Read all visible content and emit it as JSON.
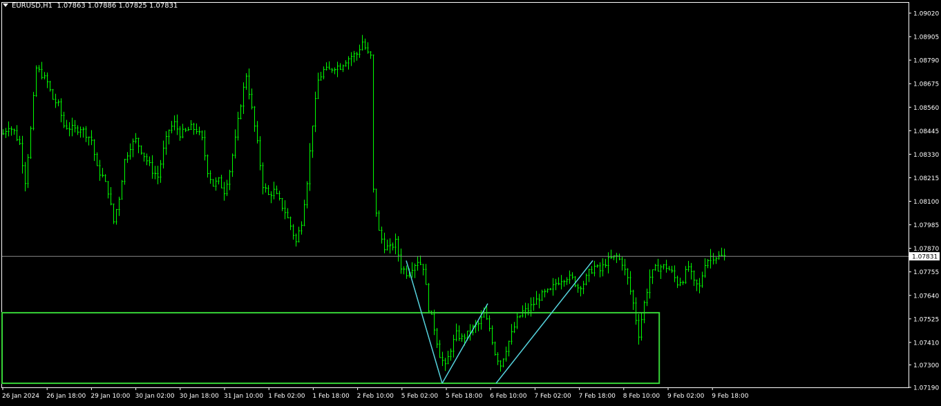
{
  "header": {
    "symbol": "EURUSD,H1",
    "ohlc": "1.07863 1.07886 1.07825 1.07831"
  },
  "colors": {
    "background": "#000000",
    "candle": "#00ff00",
    "frame": "#ffffff",
    "zone": "#37d537",
    "trendline": "#55d3dd",
    "price_line": "#8a8a8a"
  },
  "chart_data": {
    "type": "candlestick",
    "symbol": "EURUSD",
    "timeframe": "H1",
    "current_price": 1.07831,
    "current_price_label": "1.07831",
    "ylim": [
      1.0714,
      1.091
    ],
    "y_ticks": [
      "1.09020",
      "1.08905",
      "1.08790",
      "1.08675",
      "1.08560",
      "1.08445",
      "1.08330",
      "1.08215",
      "1.08100",
      "1.07985",
      "1.07870",
      "1.07755",
      "1.07640",
      "1.07525",
      "1.07410",
      "1.07300",
      "1.07190"
    ],
    "x_ticks": [
      "26 Jan 2024",
      "26 Jan 18:00",
      "29 Jan 10:00",
      "30 Jan 02:00",
      "30 Jan 18:00",
      "31 Jan 10:00",
      "1 Feb 02:00",
      "1 Feb 18:00",
      "2 Feb 10:00",
      "5 Feb 02:00",
      "5 Feb 18:00",
      "6 Feb 10:00",
      "7 Feb 02:00",
      "7 Feb 18:00",
      "8 Feb 10:00",
      "9 Feb 02:00",
      "9 Feb 18:00"
    ],
    "close_path": [
      [
        0,
        1.0843
      ],
      [
        8,
        1.0847
      ],
      [
        16,
        1.0844
      ],
      [
        24,
        1.0838
      ],
      [
        32,
        1.082
      ],
      [
        40,
        1.0845
      ],
      [
        48,
        1.0875
      ],
      [
        56,
        1.0872
      ],
      [
        64,
        1.0868
      ],
      [
        72,
        1.086
      ],
      [
        80,
        1.0857
      ],
      [
        88,
        1.0847
      ],
      [
        96,
        1.0846
      ],
      [
        104,
        1.0845
      ],
      [
        112,
        1.0846
      ],
      [
        120,
        1.0843
      ],
      [
        128,
        1.084
      ],
      [
        136,
        1.0826
      ],
      [
        144,
        1.0822
      ],
      [
        152,
        1.0815
      ],
      [
        160,
        1.08
      ],
      [
        168,
        1.0812
      ],
      [
        176,
        1.083
      ],
      [
        184,
        1.0837
      ],
      [
        192,
        1.084
      ],
      [
        200,
        1.0835
      ],
      [
        208,
        1.083
      ],
      [
        216,
        1.0825
      ],
      [
        224,
        1.0822
      ],
      [
        232,
        1.0835
      ],
      [
        240,
        1.0845
      ],
      [
        248,
        1.0848
      ],
      [
        256,
        1.0843
      ],
      [
        264,
        1.0844
      ],
      [
        272,
        1.0846
      ],
      [
        280,
        1.0845
      ],
      [
        288,
        1.084
      ],
      [
        296,
        1.0825
      ],
      [
        304,
        1.0818
      ],
      [
        312,
        1.082
      ],
      [
        320,
        1.0815
      ],
      [
        328,
        1.0825
      ],
      [
        336,
        1.084
      ],
      [
        344,
        1.0858
      ],
      [
        352,
        1.0872
      ],
      [
        360,
        1.0855
      ],
      [
        368,
        1.0838
      ],
      [
        376,
        1.0818
      ],
      [
        384,
        1.0813
      ],
      [
        392,
        1.0815
      ],
      [
        400,
        1.081
      ],
      [
        408,
        1.0805
      ],
      [
        416,
        1.0798
      ],
      [
        424,
        1.079
      ],
      [
        432,
        1.08
      ],
      [
        440,
        1.082
      ],
      [
        448,
        1.0848
      ],
      [
        456,
        1.0869
      ],
      [
        464,
        1.0874
      ],
      [
        472,
        1.0874
      ],
      [
        480,
        1.0876
      ],
      [
        488,
        1.0876
      ],
      [
        496,
        1.0879
      ],
      [
        504,
        1.0881
      ],
      [
        512,
        1.0882
      ],
      [
        520,
        1.0888
      ],
      [
        528,
        1.0882
      ],
      [
        534,
        1.088
      ],
      [
        536,
        1.0815
      ],
      [
        544,
        1.0795
      ],
      [
        552,
        1.0788
      ],
      [
        560,
        1.0787
      ],
      [
        568,
        1.079
      ],
      [
        576,
        1.0778
      ],
      [
        584,
        1.0775
      ],
      [
        592,
        1.0778
      ],
      [
        600,
        1.0781
      ],
      [
        608,
        1.0778
      ],
      [
        616,
        1.0758
      ],
      [
        624,
        1.0748
      ],
      [
        632,
        1.0735
      ],
      [
        640,
        1.0729
      ],
      [
        648,
        1.0738
      ],
      [
        656,
        1.0745
      ],
      [
        664,
        1.0743
      ],
      [
        672,
        1.0745
      ],
      [
        680,
        1.0748
      ],
      [
        688,
        1.075
      ],
      [
        696,
        1.0755
      ],
      [
        704,
        1.0748
      ],
      [
        712,
        1.0736
      ],
      [
        720,
        1.073
      ],
      [
        728,
        1.0738
      ],
      [
        736,
        1.0745
      ],
      [
        744,
        1.0752
      ],
      [
        752,
        1.0756
      ],
      [
        760,
        1.0757
      ],
      [
        768,
        1.076
      ],
      [
        776,
        1.0763
      ],
      [
        784,
        1.0765
      ],
      [
        792,
        1.0766
      ],
      [
        800,
        1.077
      ],
      [
        808,
        1.0772
      ],
      [
        816,
        1.0773
      ],
      [
        824,
        1.0772
      ],
      [
        832,
        1.0768
      ],
      [
        840,
        1.077
      ],
      [
        848,
        1.0775
      ],
      [
        856,
        1.0778
      ],
      [
        864,
        1.0776
      ],
      [
        872,
        1.078
      ],
      [
        880,
        1.0782
      ],
      [
        888,
        1.0783
      ],
      [
        896,
        1.078
      ],
      [
        904,
        1.0772
      ],
      [
        912,
        1.076
      ],
      [
        920,
        1.0745
      ],
      [
        928,
        1.076
      ],
      [
        936,
        1.0773
      ],
      [
        944,
        1.0777
      ],
      [
        952,
        1.0778
      ],
      [
        960,
        1.0778
      ],
      [
        968,
        1.0775
      ],
      [
        976,
        1.077
      ],
      [
        984,
        1.0772
      ],
      [
        992,
        1.0778
      ],
      [
        1000,
        1.077
      ],
      [
        1008,
        1.0768
      ],
      [
        1016,
        1.078
      ],
      [
        1024,
        1.0783
      ],
      [
        1032,
        1.0783
      ],
      [
        1040,
        1.0783
      ],
      [
        1046,
        1.0783
      ]
    ],
    "support_zone": {
      "price_top": 1.07555,
      "price_bottom": 1.0721,
      "start": "26 Jan 2024",
      "end": "8 Feb"
    },
    "trendlines": [
      {
        "from": [
          "5 Feb 02:00",
          1.0781
        ],
        "to": [
          "5 Feb 18:00",
          1.0721
        ]
      },
      {
        "from": [
          "5 Feb 18:00",
          1.0721
        ],
        "to": [
          "6 Feb 10:00",
          1.076
        ]
      },
      {
        "from": [
          "6 Feb 10:00",
          1.0721
        ],
        "to": [
          "7 Feb 18:00",
          1.0781
        ]
      }
    ],
    "grid": false
  }
}
